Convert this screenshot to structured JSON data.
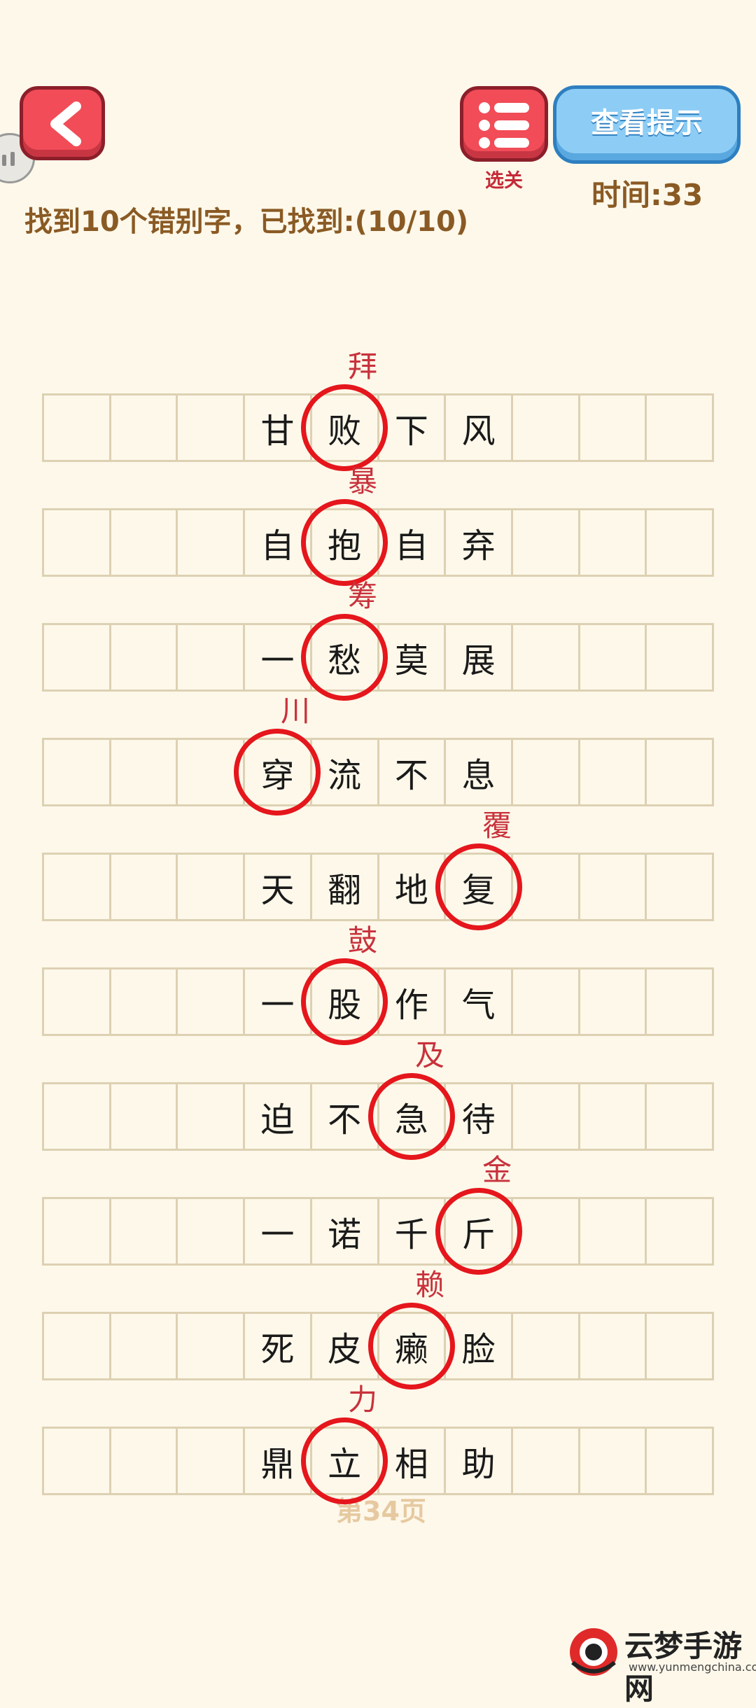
{
  "header": {
    "back_icon": "chevron-left-icon",
    "menu_icon": "list-icon",
    "menu_label": "选关",
    "hint_label": "查看提示",
    "timer": "时间:33",
    "instructions": "找到10个错别字，已找到:(10/10)"
  },
  "colors": {
    "accent_red": "#f14c57",
    "hint_blue": "#8dcdf5",
    "text_brown": "#8a5a24",
    "circle_red": "#e5161c"
  },
  "rows": [
    {
      "cells": [
        "",
        "",
        "",
        "甘",
        "败",
        "下",
        "风",
        "",
        "",
        ""
      ],
      "wrong_index": 4,
      "correction": "拜"
    },
    {
      "cells": [
        "",
        "",
        "",
        "自",
        "抱",
        "自",
        "弃",
        "",
        "",
        ""
      ],
      "wrong_index": 4,
      "correction": "暴"
    },
    {
      "cells": [
        "",
        "",
        "",
        "一",
        "愁",
        "莫",
        "展",
        "",
        "",
        ""
      ],
      "wrong_index": 4,
      "correction": "筹"
    },
    {
      "cells": [
        "",
        "",
        "",
        "穿",
        "流",
        "不",
        "息",
        "",
        "",
        ""
      ],
      "wrong_index": 3,
      "correction": "川"
    },
    {
      "cells": [
        "",
        "",
        "",
        "天",
        "翻",
        "地",
        "复",
        "",
        "",
        ""
      ],
      "wrong_index": 6,
      "correction": "覆"
    },
    {
      "cells": [
        "",
        "",
        "",
        "一",
        "股",
        "作",
        "气",
        "",
        "",
        ""
      ],
      "wrong_index": 4,
      "correction": "鼓"
    },
    {
      "cells": [
        "",
        "",
        "",
        "迫",
        "不",
        "急",
        "待",
        "",
        "",
        ""
      ],
      "wrong_index": 5,
      "correction": "及"
    },
    {
      "cells": [
        "",
        "",
        "",
        "一",
        "诺",
        "千",
        "斤",
        "",
        "",
        ""
      ],
      "wrong_index": 6,
      "correction": "金"
    },
    {
      "cells": [
        "",
        "",
        "",
        "死",
        "皮",
        "癞",
        "脸",
        "",
        "",
        ""
      ],
      "wrong_index": 5,
      "correction": "赖"
    },
    {
      "cells": [
        "",
        "",
        "",
        "鼎",
        "立",
        "相",
        "助",
        "",
        "",
        ""
      ],
      "wrong_index": 4,
      "correction": "力"
    }
  ],
  "page_number": "第34页",
  "watermark": {
    "title": "云梦手游网",
    "url": "www.yunmengchina.com"
  }
}
